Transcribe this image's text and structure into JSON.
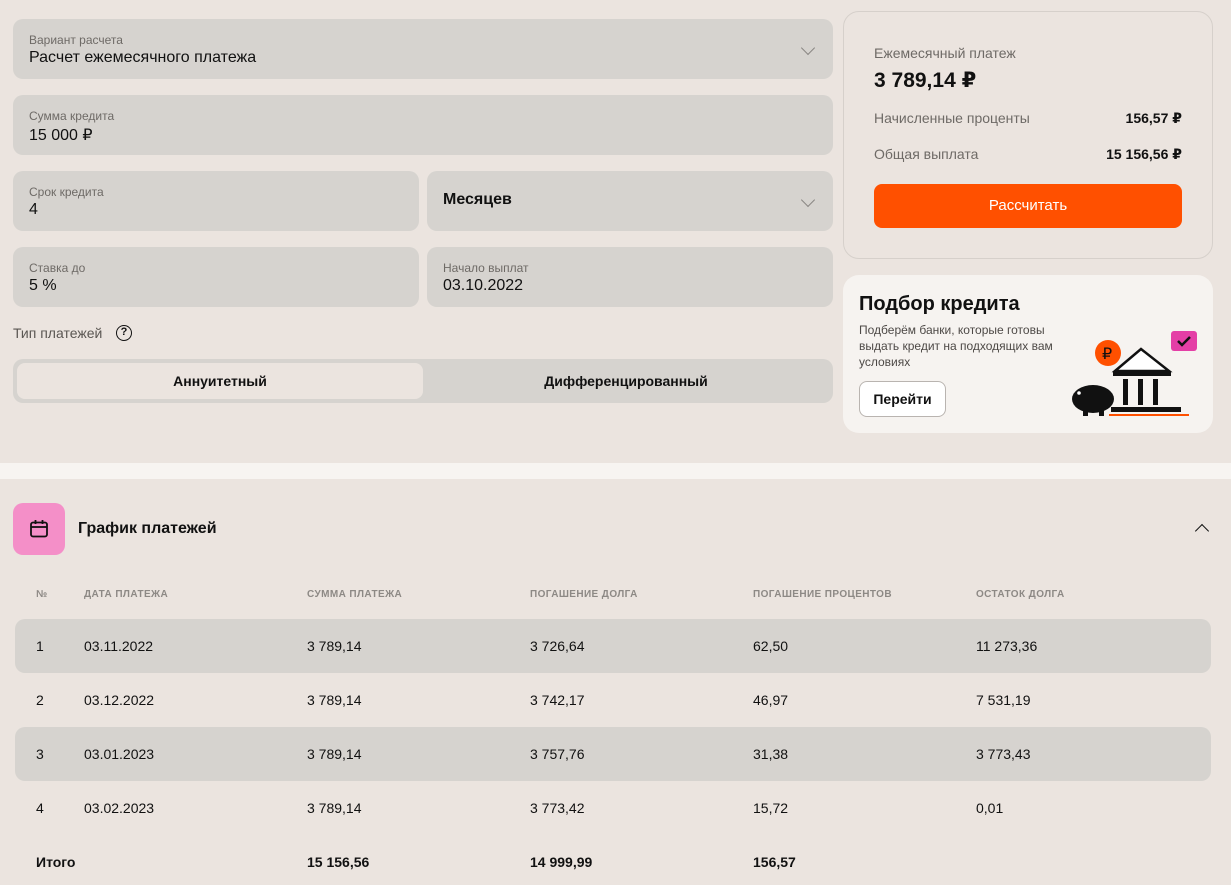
{
  "form": {
    "calc_variant": {
      "label": "Вариант расчета",
      "value": "Расчет ежемесячного платежа"
    },
    "amount": {
      "label": "Сумма кредита",
      "value": "15 000 ₽"
    },
    "term": {
      "label": "Срок кредита",
      "value": "4"
    },
    "term_unit": {
      "value": "Месяцев"
    },
    "rate": {
      "label": "Ставка до",
      "value": "5 %"
    },
    "start": {
      "label": "Начало выплат",
      "value": "03.10.2022"
    },
    "payment_type_label": "Тип платежей",
    "help_glyph": "?",
    "payment_types": [
      "Аннуитетный",
      "Дифференцированный"
    ],
    "selected_payment_type": "Аннуитетный"
  },
  "result": {
    "monthly_label": "Ежемесячный платеж",
    "monthly_value": "3 789,14 ₽",
    "interest_label": "Начисленные проценты",
    "interest_value": "156,57 ₽",
    "total_label": "Общая выплата",
    "total_value": "15 156,56 ₽",
    "calculate_button": "Рассчитать"
  },
  "promo": {
    "title": "Подбор кредита",
    "text": "Подберём банки, которые готовы выдать кредит на подходящих вам условиях",
    "button": "Перейти",
    "coin_glyph": "₽"
  },
  "schedule": {
    "title": "График платежей",
    "columns": [
      "№",
      "ДАТА ПЛАТЕЖА",
      "СУММА ПЛАТЕЖА",
      "ПОГАШЕНИЕ ДОЛГА",
      "ПОГАШЕНИЕ ПРОЦЕНТОВ",
      "ОСТАТОК ДОЛГА"
    ],
    "rows": [
      [
        "1",
        "03.11.2022",
        "3 789,14",
        "3 726,64",
        "62,50",
        "11 273,36"
      ],
      [
        "2",
        "03.12.2022",
        "3 789,14",
        "3 742,17",
        "46,97",
        "7 531,19"
      ],
      [
        "3",
        "03.01.2023",
        "3 789,14",
        "3 757,76",
        "31,38",
        "3 773,43"
      ],
      [
        "4",
        "03.02.2023",
        "3 789,14",
        "3 773,42",
        "15,72",
        "0,01"
      ]
    ],
    "totals": {
      "label": "Итого",
      "payment": "15 156,56",
      "debt": "14 999,99",
      "interest": "156,57"
    }
  },
  "colors": {
    "accent": "#ff5000",
    "calendar_bg": "#f48fc8",
    "promo_check": "#e43fa6",
    "background": "#ebe4df"
  },
  "icons": [
    "chevron-down-icon",
    "help-icon",
    "calendar-icon",
    "chevron-up-icon",
    "bank-piggy-illustration"
  ]
}
